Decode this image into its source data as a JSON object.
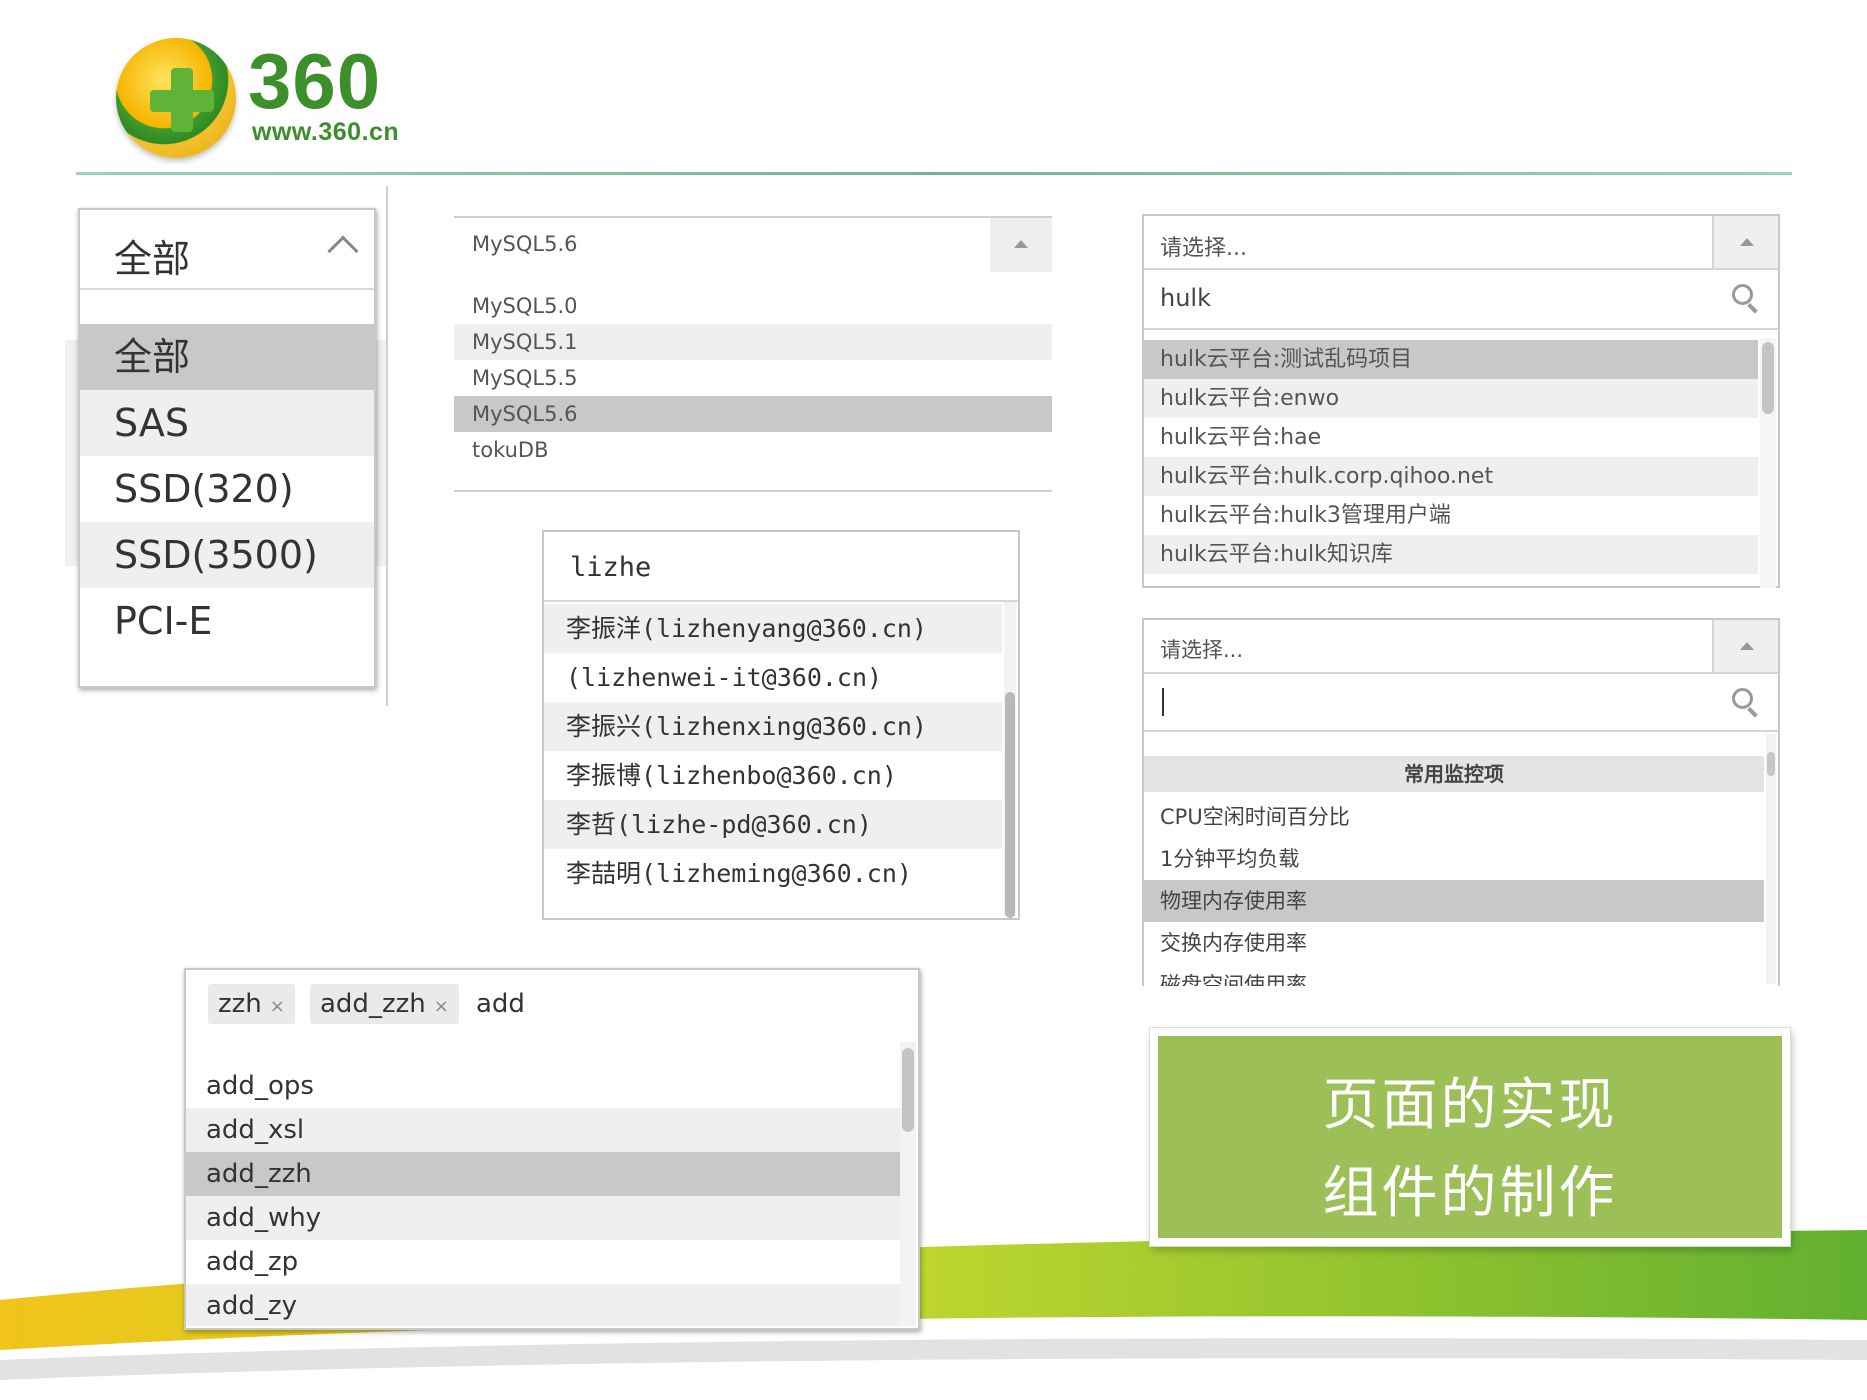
{
  "logo": {
    "number": "360",
    "url": "www.360.cn"
  },
  "dropdown_storage": {
    "value": "全部",
    "options": [
      "全部",
      "SAS",
      "SSD(320)",
      "SSD(3500)",
      "PCI-E"
    ],
    "selected_index": 0
  },
  "dropdown_mysql": {
    "value": "MySQL5.6",
    "options": [
      "MySQL5.0",
      "MySQL5.1",
      "MySQL5.5",
      "MySQL5.6",
      "tokuDB"
    ],
    "selected_index": 3
  },
  "dropdown_hulk": {
    "placeholder": "请选择...",
    "search": "hulk",
    "options": [
      "hulk云平台:测试乱码项目",
      "hulk云平台:enwo",
      "hulk云平台:hae",
      "hulk云平台:hulk.corp.qihoo.net",
      "hulk云平台:hulk3管理用户端",
      "hulk云平台:hulk知识库"
    ],
    "selected_index": 0
  },
  "dropdown_user": {
    "search": "lizhe",
    "options": [
      "李振洋(lizhenyang@360.cn)",
      "(lizhenwei-it@360.cn)",
      "李振兴(lizhenxing@360.cn)",
      "李振博(lizhenbo@360.cn)",
      "李哲(lizhe-pd@360.cn)",
      "李喆明(lizheming@360.cn)"
    ]
  },
  "dropdown_monitor": {
    "placeholder": "请选择...",
    "group_label": "常用监控项",
    "options": [
      "CPU空闲时间百分比",
      "1分钟平均负载",
      "物理内存使用率",
      "交换内存使用率",
      "磁盘空间使用率"
    ],
    "selected_index": 2
  },
  "dropdown_tags": {
    "tags": [
      "zzh",
      "add_zzh"
    ],
    "remove_symbol": "×",
    "typed": "add",
    "options": [
      "add_ops",
      "add_xsl",
      "add_zzh",
      "add_why",
      "add_zp",
      "add_zy"
    ],
    "selected_index": 2
  },
  "card": {
    "line1": "页面的实现",
    "line2": "组件的制作"
  },
  "colors": {
    "brand_green": "#3c8f2a",
    "card_green": "#9dbf58",
    "swoosh_green": "#8fc31f"
  },
  "icons": [
    "chevron-up-icon",
    "triangle-up-icon",
    "search-icon",
    "close-icon"
  ]
}
